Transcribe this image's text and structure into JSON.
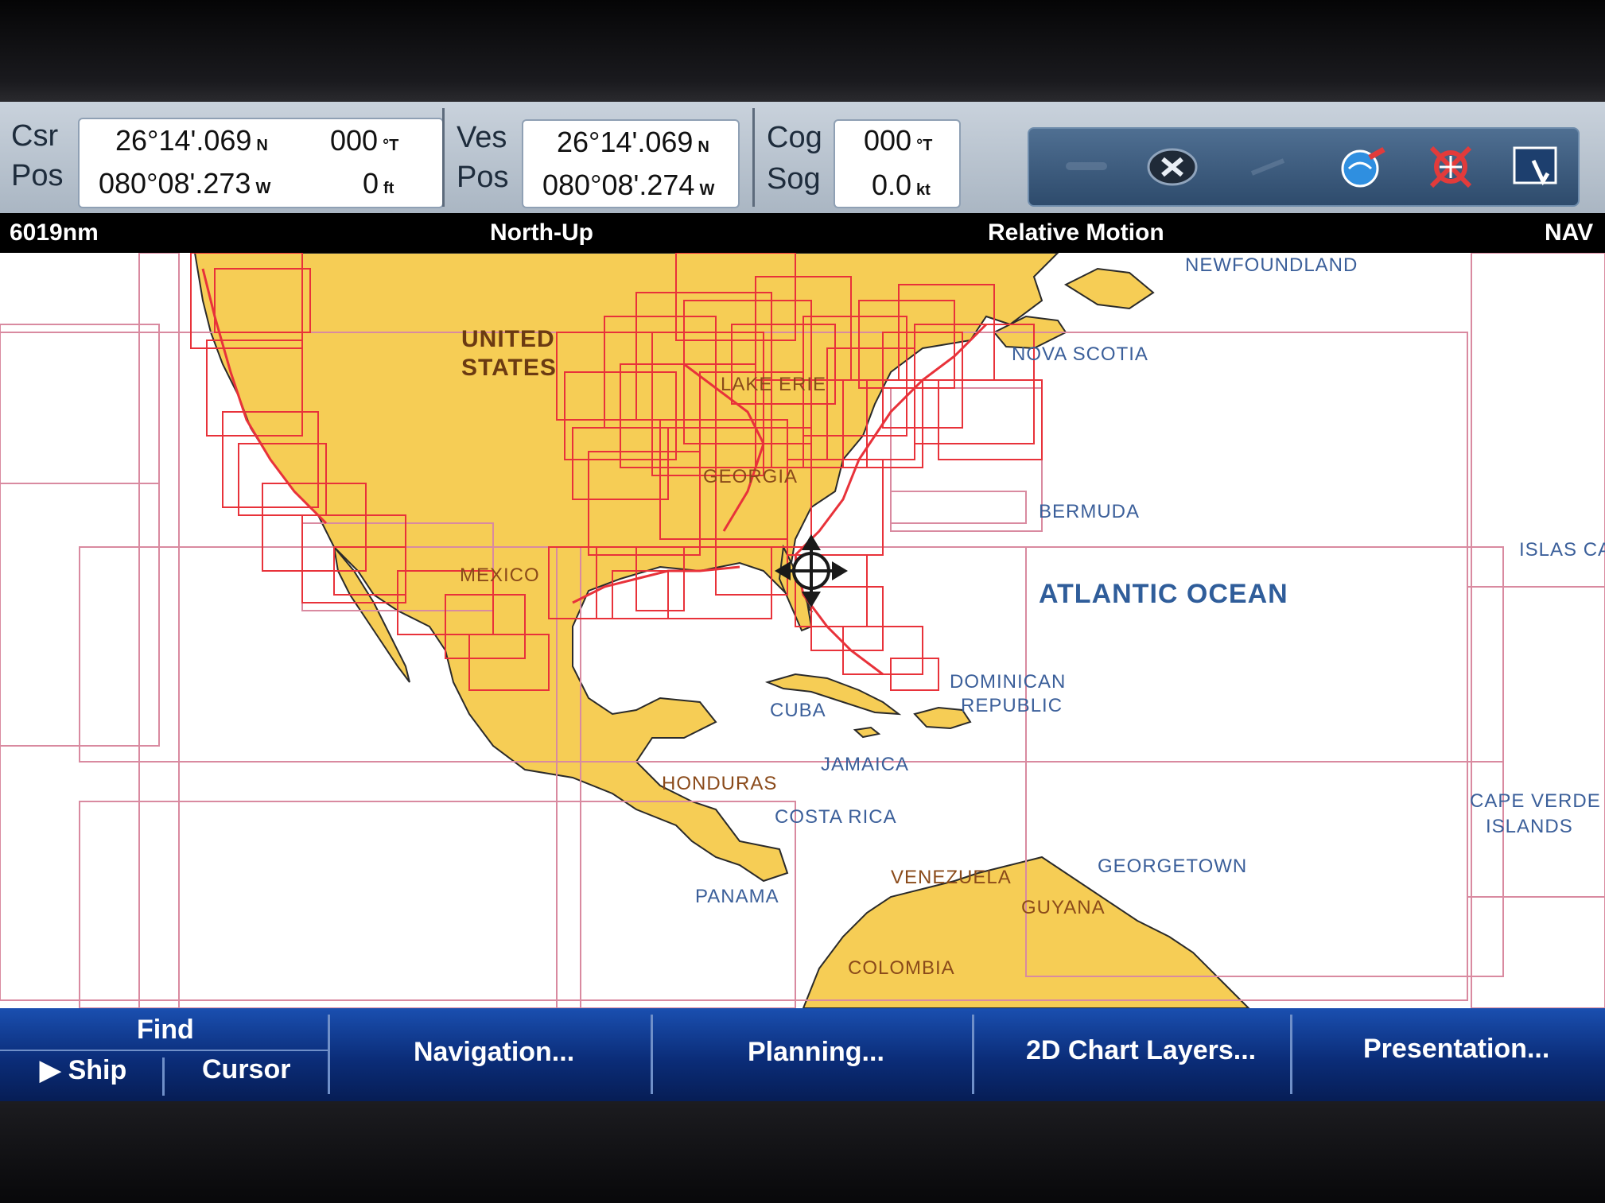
{
  "databar": {
    "csr_label": "Csr",
    "pos_label_1": "Pos",
    "csr_lat": "26°14'.069",
    "csr_lat_unit": "N",
    "csr_bearing": "000",
    "csr_bearing_unit": "°T",
    "csr_lon": "080°08'.273",
    "csr_lon_unit": "W",
    "csr_range": "0",
    "csr_range_unit": "ft",
    "ves_label": "Ves",
    "pos_label_2": "Pos",
    "ves_lat": "26°14'.069",
    "ves_lat_unit": "N",
    "ves_lon": "080°08'.274",
    "ves_lon_unit": "W",
    "cog_label": "Cog",
    "sog_label": "Sog",
    "cog_value": "000",
    "cog_unit": "°T",
    "sog_value": "0.0",
    "sog_unit": "kt"
  },
  "toolbar_icons": [
    "man-overboard-icon",
    "close-icon",
    "waypoint-icon",
    "globe-icon",
    "target-icon",
    "touch-icon"
  ],
  "status": {
    "range": "6019nm",
    "orientation": "North-Up",
    "motion": "Relative Motion",
    "mode": "NAV"
  },
  "map_labels": {
    "united": "UNITED",
    "states": "STATES",
    "lake_erie": "LAKE ERIE",
    "georgia": "GEORGIA",
    "mexico": "MEXICO",
    "newfoundland": "NEWFOUNDLAND",
    "nova_scotia": "NOVA SCOTIA",
    "bermuda": "BERMUDA",
    "atlantic_ocean": "ATLANTIC OCEAN",
    "islas_canarias": "ISLAS CA",
    "dominican": "DOMINICAN",
    "republic": "REPUBLIC",
    "cuba": "CUBA",
    "jamaica": "JAMAICA",
    "honduras": "HONDURAS",
    "costa_rica": "COSTA RICA",
    "cape_verde_1": "CAPE VERDE",
    "cape_verde_2": "ISLANDS",
    "georgetown": "GEORGETOWN",
    "venezuela": "VENEZUELA",
    "guyana": "GUYANA",
    "panama": "PANAMA",
    "colombia": "COLOMBIA"
  },
  "softkeys": {
    "find": "Find",
    "ship": "Ship",
    "cursor": "Cursor",
    "navigation": "Navigation...",
    "planning": "Planning...",
    "chart_layers": "2D Chart Layers...",
    "presentation": "Presentation..."
  },
  "colors": {
    "land": "#f6cd55",
    "chart_outline_dense": "#e8323a",
    "chart_outline_light": "#d98aa0",
    "sea": "#ffffff",
    "softkey_bar": "#0b2d79"
  }
}
